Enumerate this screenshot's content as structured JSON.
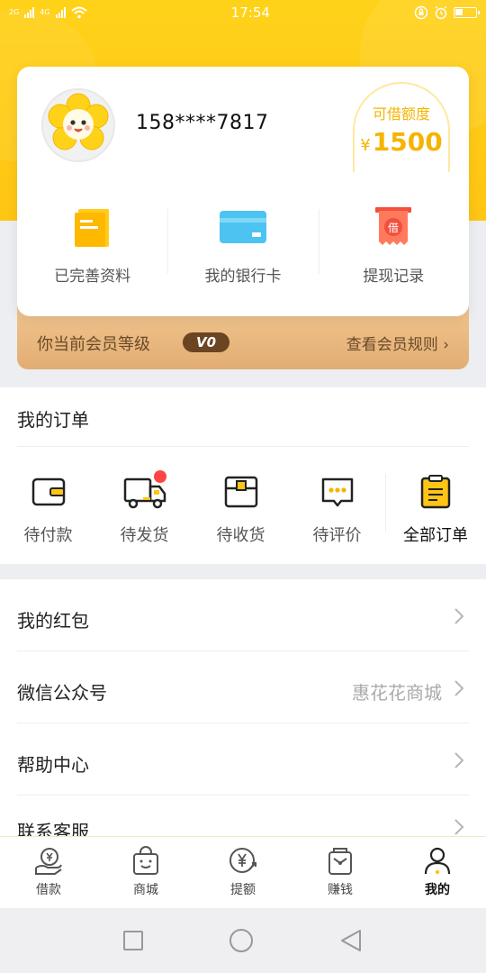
{
  "status_bar": {
    "time": "17:54",
    "network_label": "4G",
    "network_label2": "2G"
  },
  "user": {
    "phone": "158****7817",
    "avatar_icon": "flower-avatar-icon"
  },
  "credit": {
    "label": "可借额度",
    "currency": "¥",
    "amount": "1500"
  },
  "quick_actions": [
    {
      "label": "已完善资料",
      "icon": "document-icon"
    },
    {
      "label": "我的银行卡",
      "icon": "bank-card-icon"
    },
    {
      "label": "提现记录",
      "icon": "loan-receipt-icon",
      "icon_text": "借"
    }
  ],
  "member": {
    "text": "你当前会员等级",
    "level": "V0",
    "rule_link": "查看会员规则 ›"
  },
  "orders": {
    "title": "我的订单",
    "items": [
      {
        "label": "待付款",
        "icon": "wallet-icon"
      },
      {
        "label": "待发货",
        "icon": "delivery-truck-icon",
        "has_dot": true
      },
      {
        "label": "待收货",
        "icon": "package-box-icon"
      },
      {
        "label": "待评价",
        "icon": "comment-bubble-icon"
      },
      {
        "label": "全部订单",
        "icon": "clipboard-list-icon"
      }
    ]
  },
  "menu": [
    {
      "label": "我的红包",
      "value": ""
    },
    {
      "label": "微信公众号",
      "value": "惠花花商城"
    },
    {
      "label": "帮助中心",
      "value": ""
    },
    {
      "label": "联系客服",
      "value": ""
    }
  ],
  "tabbar": [
    {
      "label": "借款",
      "icon": "loan-hand-yen-icon",
      "active": false
    },
    {
      "label": "商城",
      "icon": "shopping-bag-icon",
      "active": false
    },
    {
      "label": "提额",
      "icon": "yen-up-icon",
      "active": false
    },
    {
      "label": "赚钱",
      "icon": "earn-bag-icon",
      "active": false
    },
    {
      "label": "我的",
      "icon": "user-profile-icon",
      "active": true
    }
  ],
  "colors": {
    "brand_yellow": "#ffc514",
    "credit_text": "#f5b400",
    "member_bg": "#e2ad73",
    "badge_bg": "#6b4422",
    "notice_dot": "#ff4444"
  }
}
